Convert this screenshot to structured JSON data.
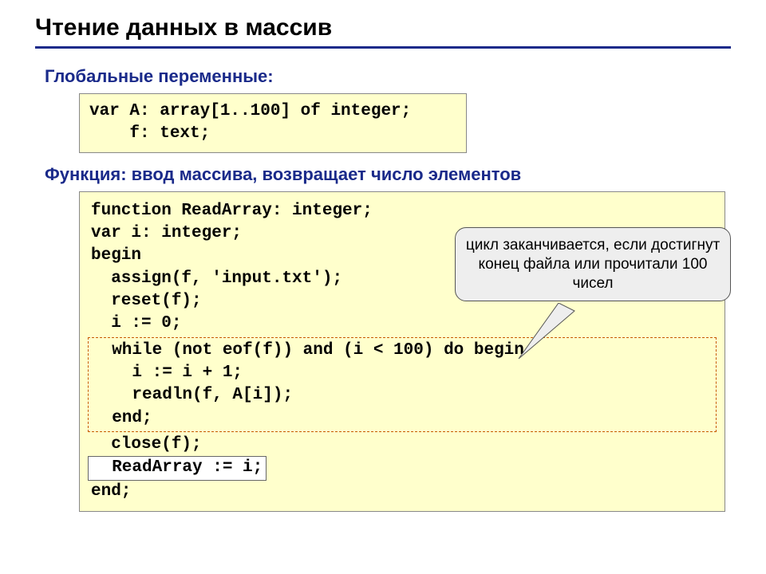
{
  "title": "Чтение данных в массив",
  "subhead1": "Глобальные переменные:",
  "code1": {
    "l1": "var A: array[1..100] of integer;",
    "l2": "    f: text;"
  },
  "subhead2": "Функция: ввод массива, возвращает число элементов",
  "code2": {
    "l1": "function ReadArray: integer;",
    "l2": "var i: integer;",
    "l3": "begin",
    "l4": "  assign(f, 'input.txt');",
    "l5": "  reset(f);",
    "l6": "  i := 0;",
    "l7": "  while (not eof(f)) and (i < 100) do begin",
    "l8": "    i := i + 1;",
    "l9": "    readln(f, A[i]);",
    "l10": "  end;",
    "l11": "  close(f);",
    "l12": "  ReadArray := i;",
    "l13": "end;"
  },
  "callout": "цикл заканчивается, если достигнут конец файла или прочитали 100 чисел"
}
